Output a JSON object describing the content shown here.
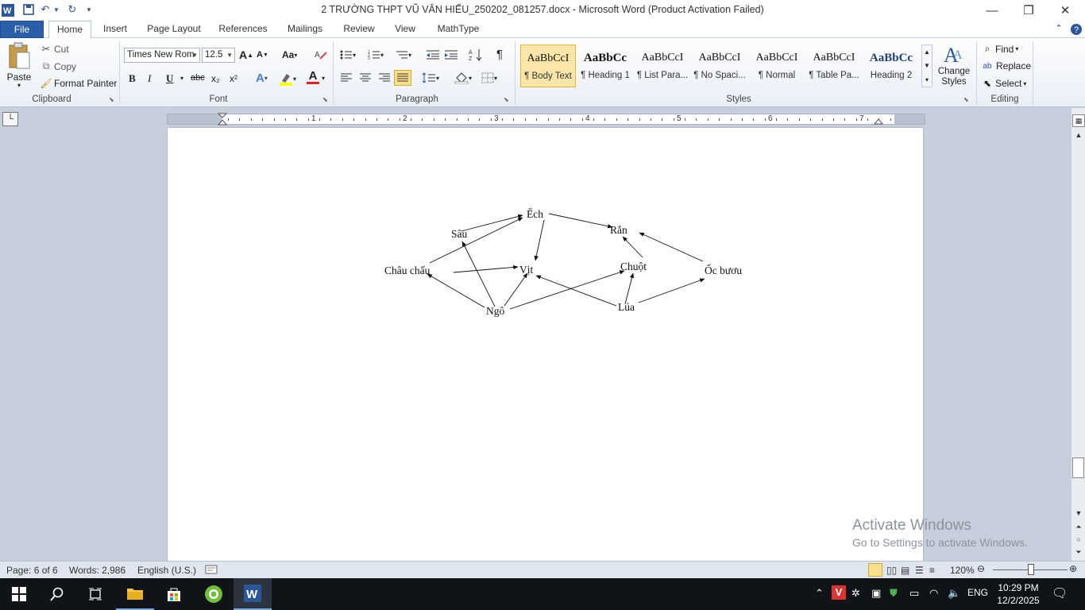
{
  "window": {
    "title": "2 TRƯỜNG THPT  VŨ VĂN HIẾU_250202_081257.docx  -  Microsoft Word (Product Activation Failed)"
  },
  "tabs": [
    "File",
    "Home",
    "Insert",
    "Page Layout",
    "References",
    "Mailings",
    "Review",
    "View",
    "MathType"
  ],
  "active_tab": "Home",
  "clipboard": {
    "paste": "Paste",
    "cut": "Cut",
    "copy": "Copy",
    "format_painter": "Format Painter",
    "label": "Clipboard"
  },
  "font": {
    "name": "Times New Rom",
    "size": "12.5",
    "bold": "B",
    "italic": "I",
    "underline": "U",
    "strike": "abc",
    "subscript": "x₂",
    "superscript": "x²",
    "change_case": "Aa",
    "grow": "A",
    "shrink": "A",
    "label": "Font"
  },
  "paragraph": {
    "label": "Paragraph",
    "show_marks": "¶"
  },
  "styles": {
    "label": "Styles",
    "items": [
      {
        "sample": "AaBbCcI",
        "name": "¶ Body Text"
      },
      {
        "sample": "AaBbCc",
        "name": "¶ Heading 1"
      },
      {
        "sample": "AaBbCcI",
        "name": "¶ List Para..."
      },
      {
        "sample": "AaBbCcI",
        "name": "¶ No Spaci..."
      },
      {
        "sample": "AaBbCcI",
        "name": "¶ Normal"
      },
      {
        "sample": "AaBbCcI",
        "name": "¶ Table Pa..."
      },
      {
        "sample": "AaBbCc",
        "name": "Heading 2"
      }
    ],
    "change_styles": "Change Styles"
  },
  "editing": {
    "label": "Editing",
    "find": "Find",
    "replace": "Replace",
    "select": "Select"
  },
  "ruler_numbers": [
    "1",
    "2",
    "3",
    "4",
    "5",
    "6",
    "7"
  ],
  "food_web": {
    "nodes": [
      "Ếch",
      "Sâu",
      "Rắn",
      "Châu chấu",
      "Vịt",
      "Chuột",
      "Ốc bươu",
      "Ngô",
      "Lúa"
    ]
  },
  "watermark": {
    "title": "Activate Windows",
    "subtitle": "Go to Settings to activate Windows."
  },
  "status": {
    "page": "Page: 6 of 6",
    "words": "Words: 2,986",
    "language": "English (U.S.)",
    "zoom": "120%"
  },
  "taskbar": {
    "language": "ENG",
    "time": "10:29 PM",
    "date": "12/2/2025"
  },
  "colors": {
    "accent": "#2b579a",
    "file_tab": "#2a5ea8",
    "taskbar": "#101418",
    "page_bg": "#c6cfdb"
  }
}
